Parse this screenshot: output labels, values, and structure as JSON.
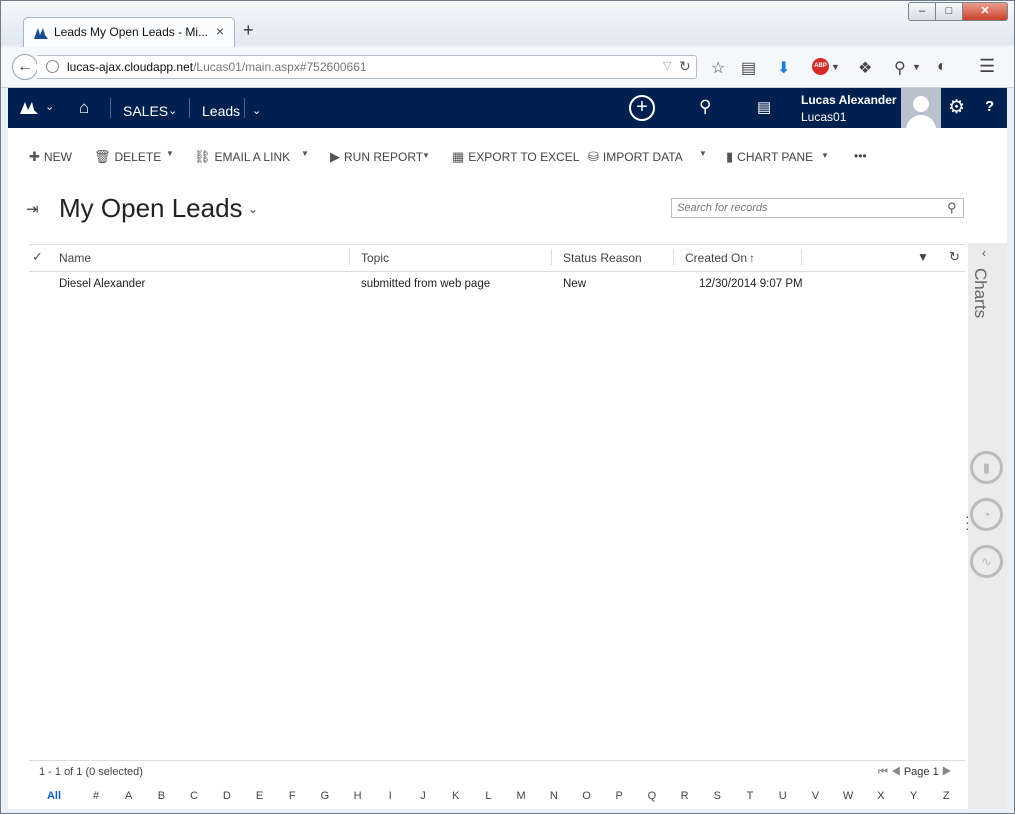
{
  "browser": {
    "tab_title": "Leads My Open Leads - Mi...",
    "tab_close": "×",
    "new_tab": "+",
    "window_controls": {
      "minimize": "–",
      "maximize": "□",
      "close": "✕"
    },
    "url_host": "lucas-ajax.cloudapp.net",
    "url_path": "/Lucas01/main.aspx#752600661"
  },
  "crm_nav": {
    "area": "SALES",
    "entity": "Leads",
    "user_name": "Lucas Alexander",
    "user_org": "Lucas01",
    "help": "?",
    "brand_color": "#002050"
  },
  "command_bar": {
    "new": "NEW",
    "delete": "DELETE",
    "email_link": "EMAIL A LINK",
    "run_report": "RUN REPORT",
    "export_excel": "EXPORT TO EXCEL",
    "import_data": "IMPORT DATA",
    "chart_pane": "CHART PANE",
    "more": "•••"
  },
  "view": {
    "title": "My Open Leads",
    "search_placeholder": "Search for records"
  },
  "grid": {
    "columns": [
      "Name",
      "Topic",
      "Status Reason",
      "Created On"
    ],
    "sort_icon": "↑",
    "rows": [
      {
        "name": "Diesel Alexander",
        "topic": "submitted from web page",
        "status": "New",
        "created_on": "12/30/2014 9:07 PM"
      }
    ]
  },
  "footer": {
    "record_count": "1 - 1 of 1 (0 selected)",
    "page": "Page 1",
    "alpha": [
      "All",
      "#",
      "A",
      "B",
      "C",
      "D",
      "E",
      "F",
      "G",
      "H",
      "I",
      "J",
      "K",
      "L",
      "M",
      "N",
      "O",
      "P",
      "Q",
      "R",
      "S",
      "T",
      "U",
      "V",
      "W",
      "X",
      "Y",
      "Z"
    ],
    "active_alpha": "All"
  },
  "charts_rail": {
    "label": "Charts"
  },
  "icons": {
    "back": "back-arrow-icon",
    "home": "home-icon",
    "create": "plus-circle-icon",
    "search": "search-icon",
    "advanced_find": "advanced-find-icon",
    "settings": "gear-icon",
    "filter": "filter-icon",
    "refresh": "refresh-icon"
  }
}
